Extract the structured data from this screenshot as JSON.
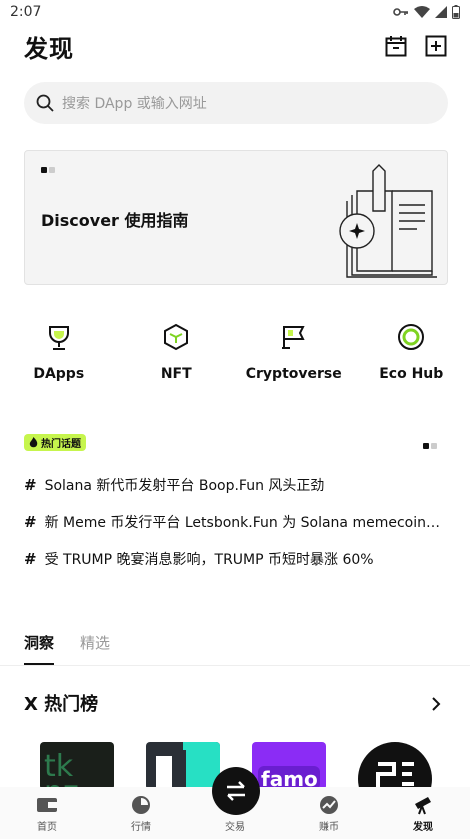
{
  "status_bar": {
    "time": "2:07"
  },
  "header": {
    "title": "发现"
  },
  "search": {
    "placeholder": "搜索 DApp 或输入网址"
  },
  "banner": {
    "title": "Discover 使用指南"
  },
  "quick_links": [
    {
      "label": "DApps",
      "icon": "trophy-icon"
    },
    {
      "label": "NFT",
      "icon": "cube-icon"
    },
    {
      "label": "Cryptoverse",
      "icon": "flag-icon"
    },
    {
      "label": "Eco Hub",
      "icon": "ring-icon"
    }
  ],
  "hot_topics": {
    "badge": "热门话题",
    "items": [
      "Solana 新代币发射平台 Boop.Fun 风头正劲",
      "新 Meme 币发行平台 Letsbonk.Fun 为 Solana memecoin…",
      "受 TRUMP 晚宴消息影响，TRUMP 币短时暴涨 60%"
    ]
  },
  "tabs": [
    "洞察",
    "精选"
  ],
  "section": {
    "title": "X 热门榜"
  },
  "bottom_nav": [
    "首页",
    "行情",
    "交易",
    "赚币",
    "发现"
  ],
  "colors": {
    "accent": "#c6f54d",
    "dark": "#111111"
  }
}
